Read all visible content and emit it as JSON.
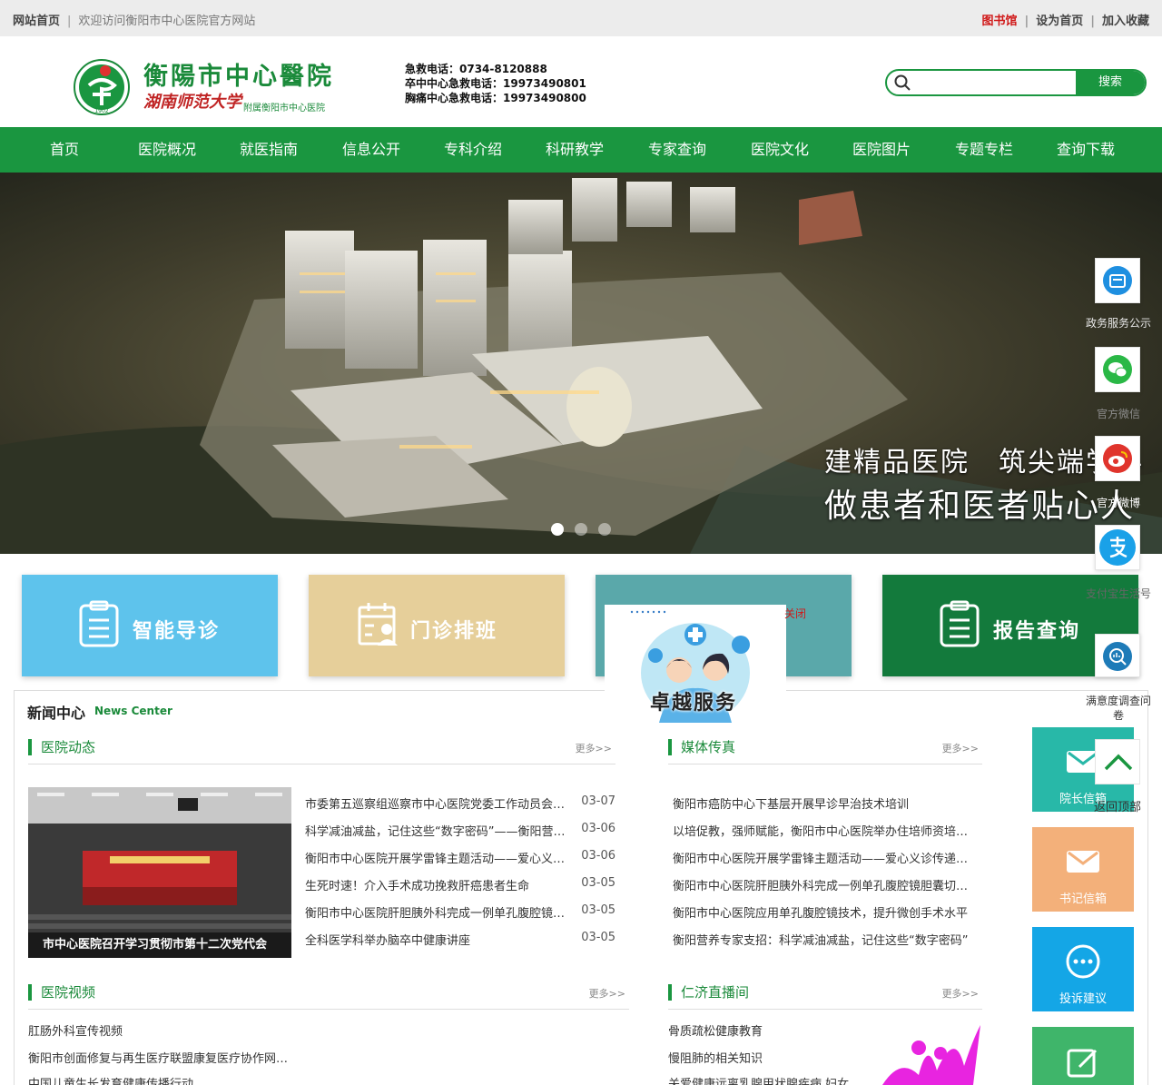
{
  "topbar": {
    "home": "网站首页",
    "welcome": "欢迎访问衡阳市中心医院官方网站",
    "library": "图书馆",
    "set_home": "设为首页",
    "favorite": "加入收藏"
  },
  "header": {
    "logo_name": "衡陽市中心醫院",
    "logo_university": "湖南师范大学",
    "logo_affiliation": "附属衡阳市中心医院",
    "logo_year": "1902",
    "hotline_1": "急救电话：0734-8120888",
    "hotline_2": "卒中中心急救电话：19973490801",
    "hotline_3": "胸痛中心急救电话：19973490800",
    "search_placeholder": "",
    "search_button": "搜索"
  },
  "nav": [
    "首页",
    "医院概况",
    "就医指南",
    "信息公开",
    "专科介绍",
    "科研教学",
    "专家查询",
    "医院文化",
    "医院图片",
    "专题专栏",
    "查询下载"
  ],
  "banner": {
    "slogan_1": "建精品医院　筑尖端学科",
    "slogan_2": "做患者和医者贴心人",
    "slide_count": 3,
    "active_slide": 0
  },
  "services": [
    {
      "label": "智能导诊",
      "color": "#5ec3ec"
    },
    {
      "label": "门诊排班",
      "color": "#e6cf9a"
    },
    {
      "label": "",
      "color": "#5aa8aa"
    },
    {
      "label": "报告查询",
      "color": "#137a3c"
    }
  ],
  "popup": {
    "close": "关闭",
    "label": "卓越服务"
  },
  "news": {
    "title": "新闻中心",
    "title_en": "News Center",
    "more": "更多>>",
    "hospital_news": {
      "title": "医院动态",
      "photo_caption": "市中心医院召开学习贯彻市第十二次党代会",
      "items": [
        {
          "text": "市委第五巡察组巡察市中心医院党委工作动员会召开",
          "date": "03-07"
        },
        {
          "text": "科学减油减盐，记住这些“数字密码”——衡阳营养专家支招",
          "date": "03-06"
        },
        {
          "text": "衡阳市中心医院开展学雷锋主题活动——爱心义诊传递温暖",
          "date": "03-06"
        },
        {
          "text": "生死时速！介入手术成功挽救肝癌患者生命",
          "date": "03-05"
        },
        {
          "text": "衡阳市中心医院肝胆胰外科完成一例单孔腹腔镜胆囊切除术",
          "date": "03-05"
        },
        {
          "text": "全科医学科举办脑卒中健康讲座",
          "date": "03-05"
        }
      ]
    },
    "media": {
      "title": "媒体传真",
      "items": [
        "衡阳市癌防中心下基层开展早诊早治技术培训",
        "以培促教，强师赋能，衡阳市中心医院举办住培师资培训班",
        "衡阳市中心医院开展学雷锋主题活动——爱心义诊传递温暖",
        "衡阳市中心医院肝胆胰外科完成一例单孔腹腔镜胆囊切除术",
        "衡阳市中心医院应用单孔腹腔镜技术，提升微创手术水平",
        "衡阳营养专家支招：科学减油减盐，记住这些“数字密码”"
      ]
    },
    "video": {
      "title": "医院视频",
      "items": [
        "肛肠外科宣传视频",
        "衡阳市创面修复与再生医疗联盟康复医疗协作网成立",
        "中国儿童生长发育健康传播行动"
      ]
    },
    "live": {
      "title": "仁济直播间",
      "items": [
        "骨质疏松健康教育",
        "慢阻肺的相关知识",
        "关爱健康远离乳腺甲状腺疾病 妇女"
      ]
    }
  },
  "float_tools": [
    {
      "label": "政务服务公示",
      "icon": "service-icon",
      "color": "#1e8fe0"
    },
    {
      "label": "官方微信",
      "icon": "wechat-icon",
      "color": "#2ab846"
    },
    {
      "label": "官方微博",
      "icon": "weibo-icon",
      "color": "#e0342c"
    },
    {
      "label": "支付宝生活号",
      "icon": "alipay-icon",
      "color": "#1aa1e8"
    },
    {
      "label": "满意度调查问卷",
      "icon": "survey-icon",
      "color": "#1e7bb8"
    }
  ],
  "side_cards": [
    {
      "label": "院长信箱",
      "color": "#28b8a8"
    },
    {
      "label": "书记信箱",
      "color": "#f3b07a"
    },
    {
      "label": "投诉建议",
      "color": "#14a6e6"
    },
    {
      "label": "",
      "color": "#3fb56a"
    }
  ],
  "back_top": "返回顶部"
}
